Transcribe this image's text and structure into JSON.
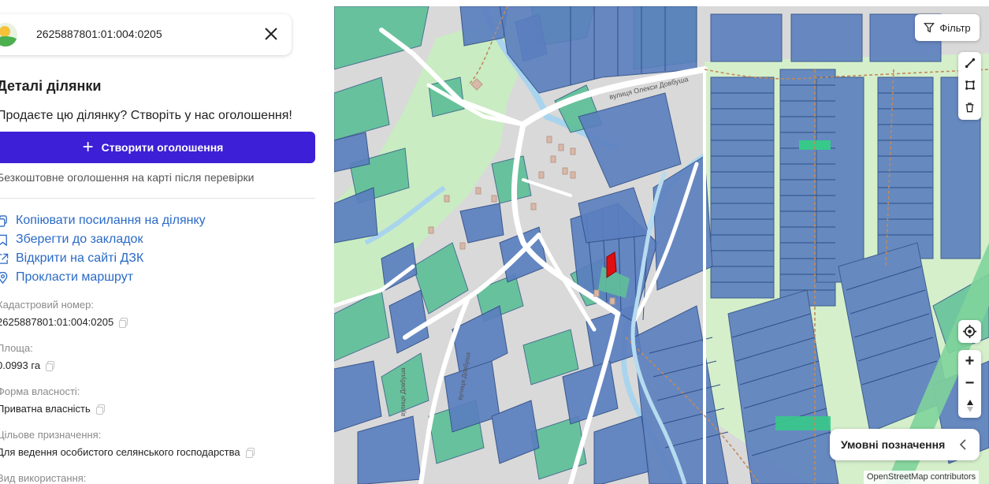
{
  "search": {
    "value": "2625887801:01:004:0205"
  },
  "panel": {
    "title": "Деталі ділянки",
    "sell_question": "Продаєте цю ділянку? Створіть у нас оголошення!",
    "create_button": "Створити оголошення",
    "free_note": "Безкоштовне оголошення на карті після перевірки",
    "actions": [
      {
        "label": "Копіювати посилання на ділянку",
        "icon": "copy-link-icon"
      },
      {
        "label": "Зберегти до закладок",
        "icon": "bookmark-icon"
      },
      {
        "label": "Відкрити на сайті ДЗК",
        "icon": "external-link-icon"
      },
      {
        "label": "Прокласти маршрут",
        "icon": "map-pin-icon"
      }
    ],
    "fields": [
      {
        "label": "Кадастровий номер:",
        "value": "2625887801:01:004:0205"
      },
      {
        "label": "Площа:",
        "value": "0.0993 га"
      },
      {
        "label": "Форма власності:",
        "value": "Приватна власність"
      },
      {
        "label": "Цільове призначення:",
        "value": "Для ведення особистого селянського господарства"
      },
      {
        "label": "Вид використання:",
        "value": ""
      }
    ]
  },
  "map": {
    "filter_label": "Фільтр",
    "legend_label": "Умовні позначення",
    "attribution": "OpenStreetMap contributors",
    "street_labels": [
      "вулиця Олекси Довбуша",
      "вулиця Довбуша",
      "вулиця Довбуша"
    ],
    "colors": {
      "parcel_blue": "#5b7fbf",
      "parcel_green": "#5fbf98",
      "selected": "#e01010",
      "road": "#ffffff",
      "park": "#c8ecc0",
      "river": "#a9d4ee"
    }
  }
}
